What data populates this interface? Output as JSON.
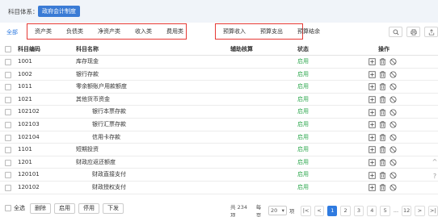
{
  "topbar": {
    "label": "科目体系：",
    "system": "政府会计制度"
  },
  "filters": {
    "all": "全部",
    "group1": [
      "资产类",
      "负债类",
      "净资产类",
      "收入类",
      "费用类"
    ],
    "group2": [
      "预算收入",
      "预算支出",
      "预算结余"
    ]
  },
  "toolbar": {
    "search_icon": "search-icon",
    "print_icon": "print-icon",
    "export_icon": "export-icon"
  },
  "table": {
    "headers": {
      "code": "科目编码",
      "name": "科目名称",
      "aux": "辅助核算",
      "status": "状态",
      "ops": "操作"
    },
    "rows": [
      {
        "code": "1001",
        "name": "库存现金",
        "level": 1,
        "status": "启用"
      },
      {
        "code": "1002",
        "name": "银行存款",
        "level": 1,
        "status": "启用"
      },
      {
        "code": "1011",
        "name": "零余额账户用款额度",
        "level": 1,
        "status": "启用"
      },
      {
        "code": "1021",
        "name": "其他货币资金",
        "level": 1,
        "status": "启用"
      },
      {
        "code": "102102",
        "name": "银行本票存款",
        "level": 2,
        "status": "启用"
      },
      {
        "code": "102103",
        "name": "银行汇票存款",
        "level": 2,
        "status": "启用"
      },
      {
        "code": "102104",
        "name": "信用卡存款",
        "level": 2,
        "status": "启用"
      },
      {
        "code": "1101",
        "name": "短期投资",
        "level": 1,
        "status": "启用"
      },
      {
        "code": "1201",
        "name": "财政应返还额度",
        "level": 1,
        "status": "启用"
      },
      {
        "code": "120101",
        "name": "财政直接支付",
        "level": 2,
        "status": "启用"
      },
      {
        "code": "120102",
        "name": "财政授权支付",
        "level": 2,
        "status": "启用"
      }
    ]
  },
  "footer": {
    "select_all": "全选",
    "buttons": [
      "删除",
      "启用",
      "停用",
      "下发"
    ],
    "total": "共 234 项",
    "per_page_label": "每页",
    "per_page": "20",
    "per_page_suffix": "项",
    "first": "|<",
    "prev": "<",
    "pages": [
      "1",
      "2",
      "3",
      "4",
      "5"
    ],
    "ellipsis": "...",
    "last_page": "12",
    "next": ">",
    "end": ">|"
  },
  "side": {
    "up": "^",
    "help": "?"
  }
}
